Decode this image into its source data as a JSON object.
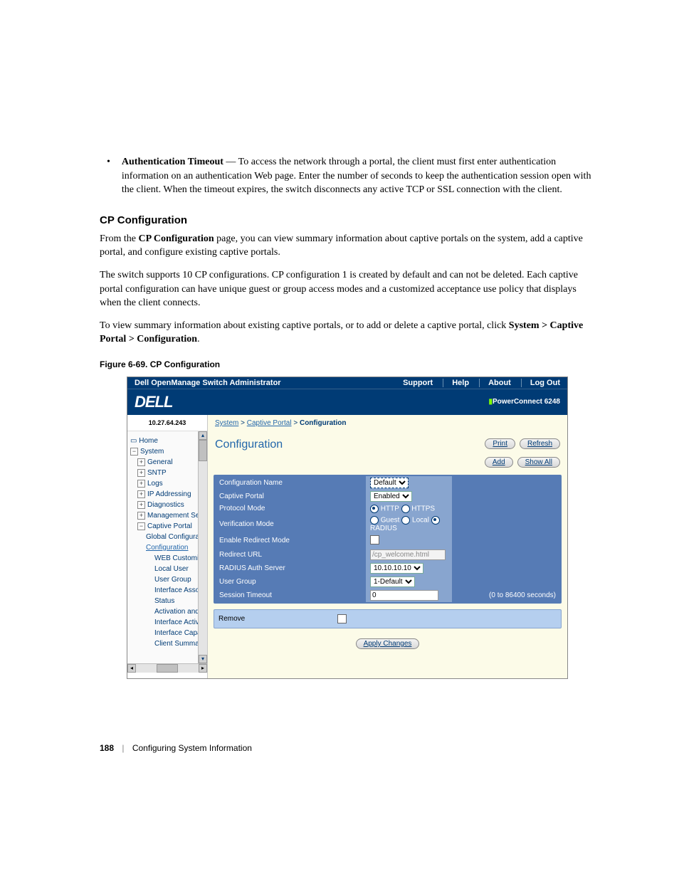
{
  "bullet": {
    "term": "Authentication Timeout",
    "text": " — To access the network through a portal, the client must first enter authentication information on an authentication Web page. Enter the number of seconds to keep the authentication session open with the client. When the timeout expires, the switch disconnects any active TCP or SSL connection with the client."
  },
  "section_heading": "CP Configuration",
  "para1_a": "From the ",
  "para1_b": "CP Configuration",
  "para1_c": " page, you can view summary information about captive portals on the system, add a captive portal, and configure existing captive portals.",
  "para2": "The switch supports 10 CP configurations. CP configuration 1 is created by default and can not be deleted. Each captive portal configuration can have unique guest or group access modes and a customized acceptance use policy that displays when the client connects.",
  "para3_a": "To view summary information about existing captive portals, or to add or delete a captive portal, click ",
  "para3_b": "System > Captive Portal > Configuration",
  "para3_c": ".",
  "figure_caption": "Figure 6-69.    CP Configuration",
  "screenshot": {
    "topbar_title": "Dell OpenManage Switch Administrator",
    "topbar_links": [
      "Support",
      "Help",
      "About",
      "Log Out"
    ],
    "logo": "DELL",
    "model": "PowerConnect 6248",
    "ip": "10.27.64.243",
    "breadcrumb": [
      "System",
      "Captive Portal",
      "Configuration"
    ],
    "page_title": "Configuration",
    "buttons_row1": [
      "Print",
      "Refresh"
    ],
    "buttons_row2": [
      "Add",
      "Show All"
    ],
    "nav": {
      "home": "Home",
      "system": "System",
      "items": [
        "General",
        "SNTP",
        "Logs",
        "IP Addressing",
        "Diagnostics",
        "Management Secur",
        "Captive Portal"
      ],
      "cp_children": [
        "Global Configurat",
        "Configuration",
        "WEB Customiza",
        "Local User",
        "User Group",
        "Interface Associa",
        "Status",
        "Activation and Ac",
        "Interface Activatio",
        "Interface Capabil",
        "Client Summary"
      ]
    },
    "form": {
      "rows": [
        {
          "label": "Configuration Name",
          "type": "select",
          "value": "Default"
        },
        {
          "label": "Captive Portal",
          "type": "select",
          "value": "Enabled"
        },
        {
          "label": "Protocol Mode",
          "type": "radio2",
          "opts": [
            "HTTP",
            "HTTPS"
          ],
          "sel": 0
        },
        {
          "label": "Verification Mode",
          "type": "radio3",
          "opts": [
            "Guest",
            "Local",
            "RADIUS"
          ],
          "sel": 2
        },
        {
          "label": "Enable Redirect Mode",
          "type": "check"
        },
        {
          "label": "Redirect URL",
          "type": "text_ro",
          "value": "/cp_welcome.html"
        },
        {
          "label": "RADIUS Auth Server",
          "type": "select",
          "value": "10.10.10.10"
        },
        {
          "label": "User Group",
          "type": "select",
          "value": "1-Default"
        },
        {
          "label": "Session Timeout",
          "type": "text",
          "value": "0",
          "hint": "(0 to 86400 seconds)"
        }
      ],
      "remove_label": "Remove",
      "apply_label": "Apply Changes"
    }
  },
  "footer": {
    "page_num": "188",
    "chapter": "Configuring System Information"
  }
}
